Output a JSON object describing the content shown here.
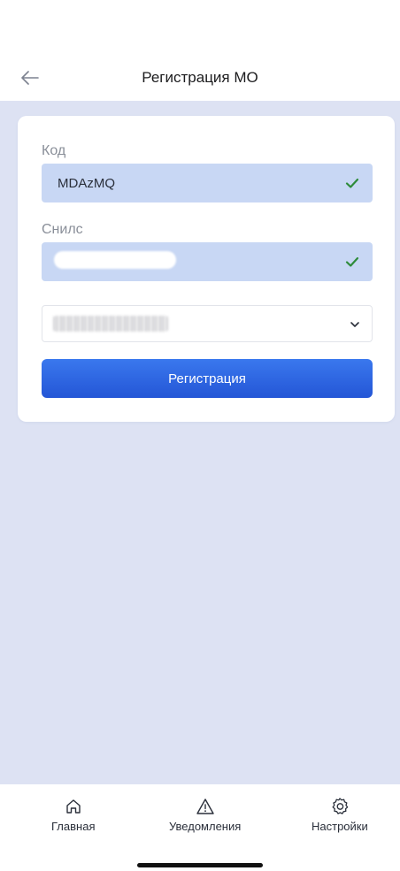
{
  "header": {
    "title": "Регистрация МО"
  },
  "form": {
    "code": {
      "label": "Код",
      "value": "MDAzMQ"
    },
    "snils": {
      "label": "Снилс"
    },
    "submit_label": "Регистрация"
  },
  "nav": {
    "items": [
      {
        "label": "Главная",
        "icon": "home-icon"
      },
      {
        "label": "Уведомления",
        "icon": "warning-icon"
      },
      {
        "label": "Настройки",
        "icon": "gear-icon"
      }
    ]
  },
  "colors": {
    "accent": "#2f66e6",
    "content_background": "#dde2f3",
    "field_background": "#c8d7f4",
    "success": "#2e8b3a"
  }
}
